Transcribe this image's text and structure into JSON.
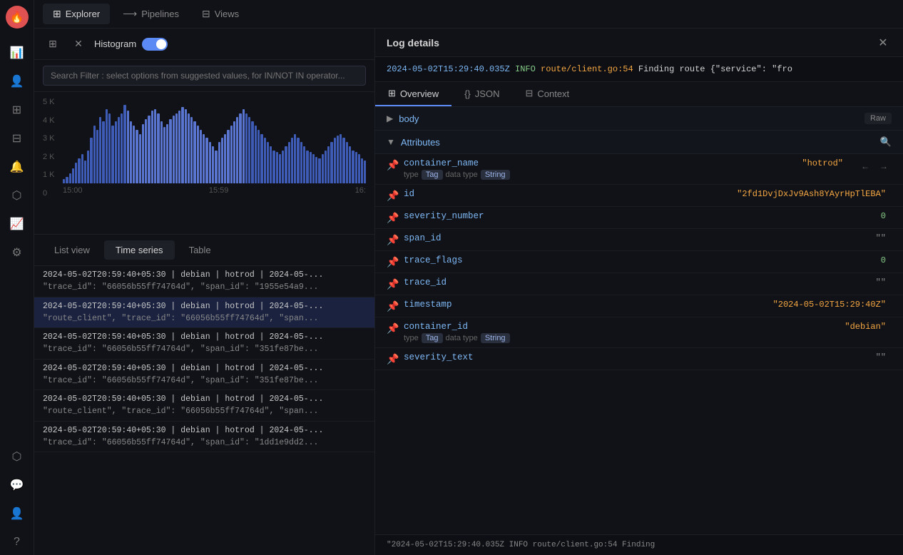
{
  "app": {
    "logo": "🔥"
  },
  "sidebar": {
    "icons": [
      {
        "name": "chart-bar-icon",
        "symbol": "📊",
        "active": false
      },
      {
        "name": "user-icon",
        "symbol": "👤",
        "active": false
      },
      {
        "name": "table-icon",
        "symbol": "⊞",
        "active": false
      },
      {
        "name": "dashboard-icon",
        "symbol": "⊟",
        "active": false
      },
      {
        "name": "bell-icon",
        "symbol": "🔔",
        "active": false
      },
      {
        "name": "explore-icon",
        "symbol": "⬡",
        "active": false
      },
      {
        "name": "analytics-icon",
        "symbol": "📈",
        "active": false
      },
      {
        "name": "settings-icon",
        "symbol": "⚙",
        "active": false
      }
    ],
    "bottom_icons": [
      {
        "name": "explore2-icon",
        "symbol": "⬡"
      },
      {
        "name": "chat-icon",
        "symbol": "💬"
      },
      {
        "name": "profile-icon",
        "symbol": "👤"
      },
      {
        "name": "help-icon",
        "symbol": "?"
      }
    ]
  },
  "topnav": {
    "tabs": [
      {
        "label": "Explorer",
        "icon": "⊞",
        "active": true
      },
      {
        "label": "Pipelines",
        "icon": "⟶",
        "active": false
      },
      {
        "label": "Views",
        "icon": "⊟",
        "active": false
      }
    ]
  },
  "toolbar": {
    "histogram_label": "Histogram",
    "toggle_on": true
  },
  "search": {
    "placeholder": "Search Filter : select options from suggested values, for IN/NOT IN operator..."
  },
  "chart": {
    "y_labels": [
      "5 K",
      "4 K",
      "3 K",
      "2 K",
      "1 K",
      "0"
    ],
    "x_labels": [
      "15:00",
      "15:59",
      "16:"
    ],
    "bars": [
      5,
      8,
      12,
      18,
      25,
      30,
      35,
      28,
      40,
      55,
      70,
      65,
      80,
      75,
      90,
      85,
      70,
      75,
      80,
      85,
      95,
      88,
      75,
      70,
      65,
      60,
      72,
      78,
      82,
      88,
      90,
      85,
      75,
      68,
      72,
      78,
      82,
      85,
      88,
      92,
      90,
      85,
      80,
      75,
      70,
      65,
      60,
      55,
      50,
      45,
      40,
      50,
      55,
      60,
      65,
      70,
      75,
      80,
      85,
      90,
      85,
      80,
      75,
      70,
      65,
      60,
      55,
      50,
      45,
      40,
      38,
      35,
      40,
      45,
      50,
      55,
      60,
      55,
      50,
      45,
      40,
      38,
      35,
      32,
      30,
      35,
      40,
      45,
      50,
      55,
      58,
      60,
      55,
      50,
      45,
      40,
      38,
      35,
      30,
      28
    ]
  },
  "view_tabs": [
    {
      "label": "List view",
      "active": false
    },
    {
      "label": "Time series",
      "active": true
    },
    {
      "label": "Table",
      "active": false
    }
  ],
  "log_rows": [
    {
      "line1": "2024-05-02T20:59:40+05:30  |  debian  |  hotrod  |  2024-05-...",
      "line2": "\"trace_id\": \"66056b55ff74764d\", \"span_id\": \"1955e54a9...",
      "selected": false
    },
    {
      "line1": "2024-05-02T20:59:40+05:30  |  debian  |  hotrod  |  2024-05-...",
      "line2": "\"route_client\", \"trace_id\": \"66056b55ff74764d\", \"span...",
      "selected": true
    },
    {
      "line1": "2024-05-02T20:59:40+05:30  |  debian  |  hotrod  |  2024-05-...",
      "line2": "\"trace_id\": \"66056b55ff74764d\", \"span_id\": \"351fe87be...",
      "selected": false
    },
    {
      "line1": "2024-05-02T20:59:40+05:30  |  debian  |  hotrod  |  2024-05-...",
      "line2": "\"trace_id\": \"66056b55ff74764d\", \"span_id\": \"351fe87be...",
      "selected": false
    },
    {
      "line1": "2024-05-02T20:59:40+05:30  |  debian  |  hotrod  |  2024-05-...",
      "line2": "\"route_client\", \"trace_id\": \"66056b55ff74764d\", \"span...",
      "selected": false
    },
    {
      "line1": "2024-05-02T20:59:40+05:30  |  debian  |  hotrod  |  2024-05-...",
      "line2": "\"trace_id\": \"66056b55ff74764d\", \"span_id\": \"1dd1e9dd2...",
      "selected": false
    }
  ],
  "log_details": {
    "title": "Log details",
    "log_preview": "2024-05-02T15:29:40.035Z  INFO  route/client.go:54  Finding route  {\"service\": \"fro",
    "tabs": [
      {
        "label": "Overview",
        "icon": "⊞",
        "active": true
      },
      {
        "label": "JSON",
        "icon": "{}",
        "active": false
      },
      {
        "label": "Context",
        "icon": "⊟",
        "active": false
      }
    ],
    "sections": {
      "body": {
        "label": "body",
        "collapsed": true,
        "raw_label": "Raw"
      },
      "attributes": {
        "label": "Attributes",
        "collapsed": false
      }
    },
    "attributes": [
      {
        "name": "container_name",
        "value": "\"hotrod\"",
        "value_type": "string",
        "has_meta": true,
        "meta_type": "Tag",
        "meta_data_type": "String",
        "has_actions": true
      },
      {
        "name": "id",
        "value": "\"2fd1DvjDxJv9Ash8YAyrHpTlEBA\"",
        "value_type": "string",
        "has_meta": false,
        "has_actions": false
      },
      {
        "name": "severity_number",
        "value": "0",
        "value_type": "number",
        "has_meta": false,
        "has_actions": false
      },
      {
        "name": "span_id",
        "value": "\"\"",
        "value_type": "empty",
        "has_meta": false,
        "has_actions": false
      },
      {
        "name": "trace_flags",
        "value": "0",
        "value_type": "number",
        "has_meta": false,
        "has_actions": false
      },
      {
        "name": "trace_id",
        "value": "\"\"",
        "value_type": "empty",
        "has_meta": false,
        "has_actions": false
      },
      {
        "name": "timestamp",
        "value": "\"2024-05-02T15:29:40Z\"",
        "value_type": "string",
        "has_meta": false,
        "has_actions": false
      },
      {
        "name": "container_id",
        "value": "\"debian\"",
        "value_type": "string",
        "has_meta": true,
        "meta_type": "Tag",
        "meta_data_type": "String",
        "has_actions": false
      },
      {
        "name": "severity_text",
        "value": "\"\"",
        "value_type": "empty",
        "has_meta": false,
        "has_actions": false
      }
    ],
    "bottom_log": "\"2024-05-02T15:29:40.035Z  INFO  route/client.go:54  Finding"
  }
}
